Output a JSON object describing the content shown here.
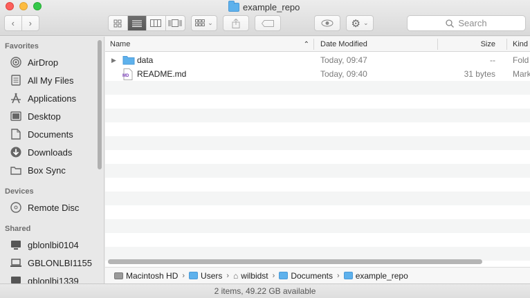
{
  "window": {
    "title": "example_repo"
  },
  "toolbar": {
    "icons": [
      "icon-view-icon",
      "list-view-icon",
      "column-view-icon",
      "coverflow-view-icon",
      "arrange-icon",
      "share-icon",
      "tag-icon",
      "quicklook-icon",
      "action-gear-icon"
    ],
    "search_placeholder": "Search"
  },
  "sidebar": {
    "favorites_header": "Favorites",
    "favorites": [
      {
        "label": "AirDrop",
        "icon": "airdrop-icon"
      },
      {
        "label": "All My Files",
        "icon": "all-files-icon"
      },
      {
        "label": "Applications",
        "icon": "applications-icon"
      },
      {
        "label": "Desktop",
        "icon": "desktop-icon"
      },
      {
        "label": "Documents",
        "icon": "documents-icon"
      },
      {
        "label": "Downloads",
        "icon": "downloads-icon"
      },
      {
        "label": "Box Sync",
        "icon": "folder-icon"
      }
    ],
    "devices_header": "Devices",
    "devices": [
      {
        "label": "Remote Disc",
        "icon": "disc-icon"
      }
    ],
    "shared_header": "Shared",
    "shared": [
      {
        "label": "gblonlbi0104",
        "icon": "computer-icon"
      },
      {
        "label": "GBLONLBI1155",
        "icon": "computer-icon"
      },
      {
        "label": "gblonlbi1339",
        "icon": "computer-icon"
      }
    ]
  },
  "columns": {
    "name": "Name",
    "date": "Date Modified",
    "size": "Size",
    "kind": "Kind"
  },
  "files": [
    {
      "name": "data",
      "date": "Today, 09:47",
      "size": "--",
      "kind": "Fold",
      "icon": "folder-icon"
    },
    {
      "name": "README.md",
      "date": "Today, 09:40",
      "size": "31 bytes",
      "kind": "Mark",
      "icon": "markdown-file-icon"
    }
  ],
  "md_badge": "MD",
  "path": [
    {
      "label": "Macintosh HD",
      "icon": "drive-icon"
    },
    {
      "label": "Users",
      "icon": "folder-icon"
    },
    {
      "label": "wilbidst",
      "icon": "home-icon"
    },
    {
      "label": "Documents",
      "icon": "folder-icon"
    },
    {
      "label": "example_repo",
      "icon": "folder-icon"
    }
  ],
  "status": "2 items, 49.22 GB available",
  "colors": {
    "folder": "#5eb1ec",
    "accent": "#0a84ff"
  }
}
